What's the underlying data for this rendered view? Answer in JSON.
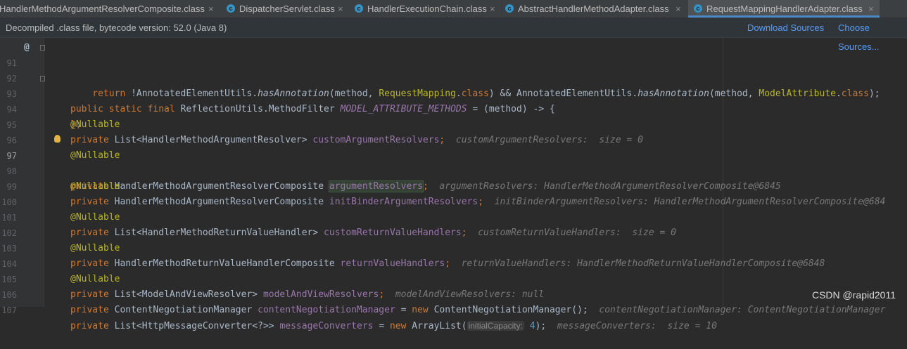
{
  "tabs": [
    {
      "label": "HandlerMethodArgumentResolverComposite.class",
      "close": "×",
      "icon": "c-class-icon"
    },
    {
      "label": "DispatcherServlet.class",
      "close": "×",
      "icon": "c-class-icon"
    },
    {
      "label": "HandlerExecutionChain.class",
      "close": "×",
      "icon": "c-class-icon"
    },
    {
      "label": "AbstractHandlerMethodAdapter.class",
      "close": "×",
      "icon": "c-class-icon"
    },
    {
      "label": "RequestMappingHandlerAdapter.class",
      "close": "×",
      "icon": "c-class-icon"
    }
  ],
  "infobar": {
    "message": "Decompiled .class file, bytecode version: 52.0 (Java 8)",
    "download_sources": "Download Sources",
    "choose_sources": "Choose Sources..."
  },
  "gutter": {
    "at_marker": "@"
  },
  "lines": {
    "l91": {
      "n": "91",
      "t1": "public static final ",
      "t2": "ReflectionUtils.MethodFilter ",
      "t3": "MODEL_ATTRIBUTE_METHODS",
      "t4": " = (method) -> {"
    },
    "l92": {
      "n": "92",
      "t1": "    return ",
      "t2": "!AnnotatedElementUtils.",
      "t3": "hasAnnotation",
      "t4": "(method, ",
      "t5": "RequestMapping",
      "t6": ".",
      "t7": "class",
      "t8": ") && AnnotatedElementUtils.",
      "t9": "hasAnnotation",
      "t10": "(method, ",
      "t11": "ModelAttribute",
      "t12": ".",
      "t13": "class",
      "t14": ");"
    },
    "l93": {
      "n": "93",
      "t1": "};"
    },
    "l94": {
      "n": "94",
      "t1": "@Nullable"
    },
    "l95": {
      "n": "95",
      "t1": "private ",
      "t2": "List<HandlerMethodArgumentResolver> ",
      "t3": "customArgumentResolvers",
      "t4": ";",
      "h": "customArgumentResolvers:  size = 0"
    },
    "l96": {
      "n": "96",
      "t1": "@Nullable"
    },
    "l97": {
      "n": "97",
      "t1": "private ",
      "t2": "HandlerMethodArgumentResolverComposite ",
      "t3": "argumentResolvers",
      "t4": ";",
      "h": "argumentResolvers: HandlerMethodArgumentResolverComposite@6845"
    },
    "l98": {
      "n": "98",
      "t1": "@Nullable"
    },
    "l99": {
      "n": "99",
      "t1": "private ",
      "t2": "HandlerMethodArgumentResolverComposite ",
      "t3": "initBinderArgumentResolvers",
      "t4": ";",
      "h": "initBinderArgumentResolvers: HandlerMethodArgumentResolverComposite@684"
    },
    "l100": {
      "n": "100",
      "t1": "@Nullable"
    },
    "l101": {
      "n": "101",
      "t1": "private ",
      "t2": "List<HandlerMethodReturnValueHandler> ",
      "t3": "customReturnValueHandlers",
      "t4": ";",
      "h": "customReturnValueHandlers:  size = 0"
    },
    "l102": {
      "n": "102",
      "t1": "@Nullable"
    },
    "l103": {
      "n": "103",
      "t1": "private ",
      "t2": "HandlerMethodReturnValueHandlerComposite ",
      "t3": "returnValueHandlers",
      "t4": ";",
      "h": "returnValueHandlers: HandlerMethodReturnValueHandlerComposite@6848"
    },
    "l104": {
      "n": "104",
      "t1": "@Nullable"
    },
    "l105": {
      "n": "105",
      "t1": "private ",
      "t2": "List<ModelAndViewResolver> ",
      "t3": "modelAndViewResolvers",
      "t4": ";",
      "h": "modelAndViewResolvers: null"
    },
    "l106": {
      "n": "106",
      "t1": "private ",
      "t2": "ContentNegotiationManager ",
      "t3": "contentNegotiationManager",
      "t4": " = ",
      "t5": "new ",
      "t6": "ContentNegotiationManager();",
      "h": "contentNegotiationManager: ContentNegotiationManager"
    },
    "l107": {
      "n": "107",
      "t1": "private ",
      "t2": "List<HttpMessageConverter<?>> ",
      "t3": "messageConverters",
      "t4": " = ",
      "t5": "new ",
      "t6": "ArrayList(",
      "p": "initialCapacity:",
      "t7": " 4",
      "t8": ");",
      "h": "messageConverters:  size = 10"
    }
  },
  "watermark": "CSDN @rapid2011",
  "colors": {
    "background": "#2b2b2b",
    "keyword": "#cc7832",
    "annotation": "#bbb529",
    "field": "#9876aa",
    "link": "#589df6"
  }
}
